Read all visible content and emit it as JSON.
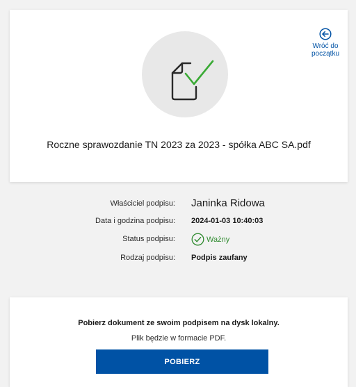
{
  "header": {
    "back_label_line1": "Wróć do",
    "back_label_line2": "początku"
  },
  "document": {
    "file_name": "Roczne sprawozdanie TN 2023 za 2023 - spółka ABC SA.pdf"
  },
  "signature": {
    "owner_label": "Właściciel podpisu:",
    "owner_value": "Janinka Ridowa",
    "datetime_label": "Data i godzina podpisu:",
    "datetime_value": "2024-01-03 10:40:03",
    "status_label": "Status podpisu:",
    "status_value": "Ważny",
    "type_label": "Rodzaj podpisu:",
    "type_value": "Podpis zaufany"
  },
  "download": {
    "title": "Pobierz dokument ze swoim podpisem na dysk lokalny.",
    "subtitle": "Plik będzie w formacie PDF.",
    "button_label": "POBIERZ"
  },
  "colors": {
    "accent": "#0052a5",
    "success": "#2e8a2e",
    "check_icon": "#3aaa35",
    "background": "#f2f2f2"
  },
  "icons": {
    "back": "arrow-left-circle-icon",
    "document": "document-check-icon",
    "status": "check-circle-icon"
  }
}
